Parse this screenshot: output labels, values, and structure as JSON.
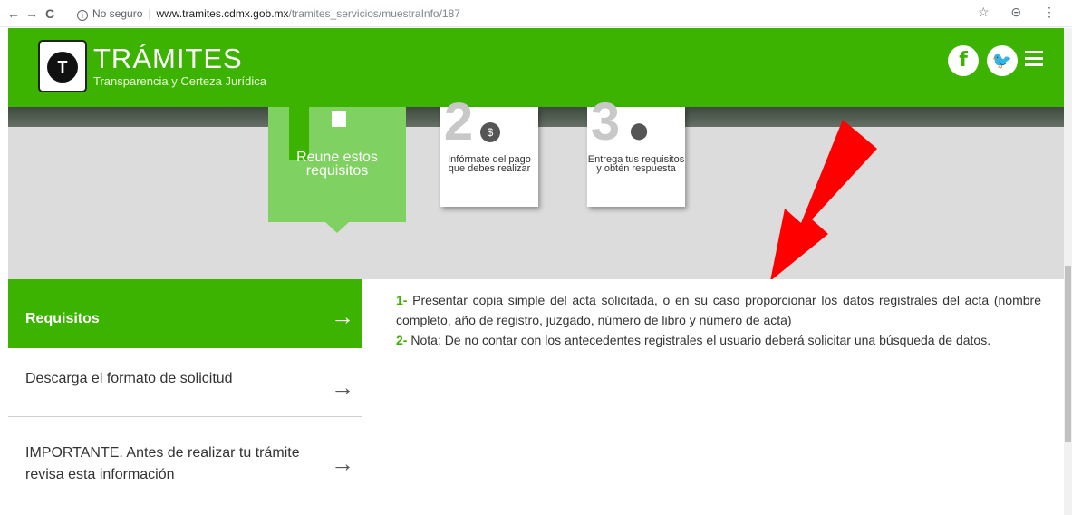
{
  "browser": {
    "back": "←",
    "forward": "→",
    "reload": "C",
    "insecure_label": "No seguro",
    "url_domain": "www.tramites.cdmx.gob.mx",
    "url_path": "/tramites_servicios/muestraInfo/187",
    "right_icons": "☆ ⊝ ⋮"
  },
  "header": {
    "logo_mark": "T",
    "title": "TRÁMITES",
    "subtitle": "Transparencia y Certeza Jurídica",
    "facebook_icon": "f",
    "twitter_icon": "🐦"
  },
  "steps": [
    {
      "number": "1",
      "label": "Reune estos requisitos"
    },
    {
      "number": "2",
      "label": "Infórmate del pago que debes realizar"
    },
    {
      "number": "3",
      "label": "Entrega tus requisitos y obtén respuesta"
    }
  ],
  "menu": [
    {
      "label": "Requisitos",
      "arrow": "→",
      "active": true
    },
    {
      "label": "Descarga el formato de solicitud",
      "arrow": "→",
      "active": false
    },
    {
      "label": "IMPORTANTE. Antes de realizar tu trámite revisa esta información",
      "arrow": "→",
      "active": false
    }
  ],
  "requirements": [
    {
      "num": "1-",
      "text": "Presentar copia simple del acta solicitada, o en su caso proporcionar los datos registrales del acta (nombre completo, año de registro, juzgado, número de libro y número de acta)"
    },
    {
      "num": "2-",
      "text": "Nota: De no contar con los antecedentes registrales el usuario deberá solicitar una búsqueda de datos."
    }
  ],
  "colors": {
    "brand_green": "#3cb300",
    "step_green": "#7fd161",
    "annotation_red": "#ff0000"
  }
}
